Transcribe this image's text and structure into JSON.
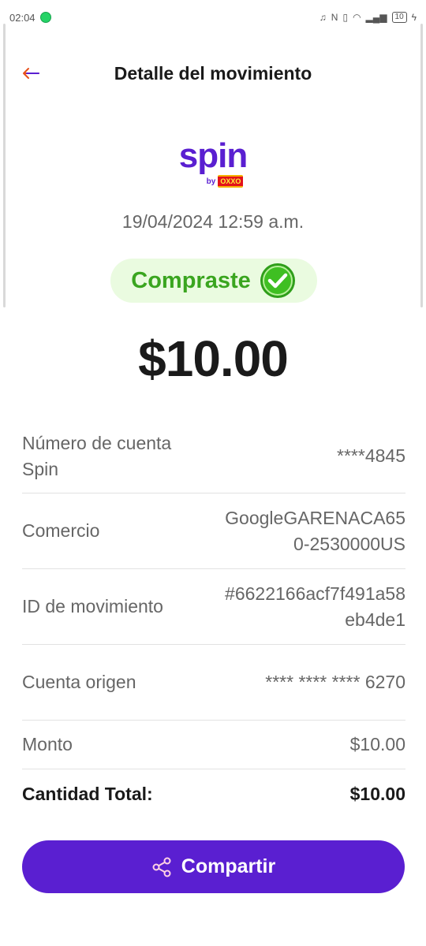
{
  "status_bar": {
    "time": "02:04",
    "battery": "10",
    "icons": [
      "whatsapp-notification-icon",
      "headphones-icon",
      "nfc-icon",
      "vibrate-icon",
      "wifi-icon",
      "signal-icon",
      "charging-icon"
    ]
  },
  "header": {
    "title": "Detalle del movimiento",
    "back_icon": "arrow-left-icon"
  },
  "logo": {
    "word": "spin",
    "by": "by",
    "brand": "OXXO"
  },
  "transaction": {
    "datetime": "19/04/2024 12:59 a.m.",
    "status": "Compraste",
    "amount": "$10.00"
  },
  "details": [
    {
      "label": "Número de cuenta Spin",
      "value": "****4845"
    },
    {
      "label": "Comercio",
      "value": "GoogleGARENACA650-2530000US"
    },
    {
      "label": "ID de movimiento",
      "value": "#6622166acf7f491a58eb4de1"
    },
    {
      "label": "Cuenta origen",
      "value": "**** **** **** 6270"
    },
    {
      "label": "Monto",
      "value": "$10.00"
    },
    {
      "label": "Cantidad Total:",
      "value": "$10.00"
    }
  ],
  "actions": {
    "share_label": "Compartir",
    "share_icon": "share-icon"
  },
  "colors": {
    "primary": "#5a1fd1",
    "success": "#3aa51f",
    "success_bg": "#eafbe0",
    "back_arrow": "#e8501a"
  }
}
